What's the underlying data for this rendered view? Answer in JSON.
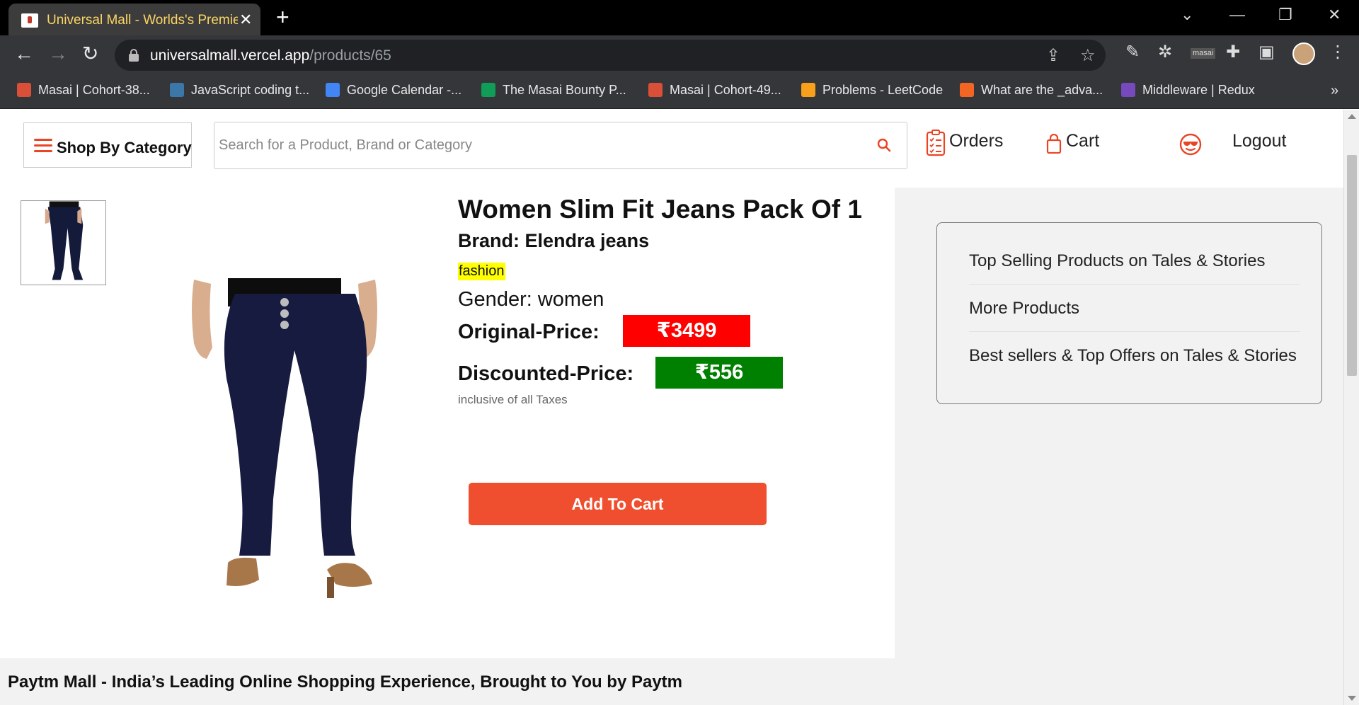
{
  "browser": {
    "tab_title": "Universal Mall - Worlds's Premier",
    "url_host": "universalmall.vercel.app",
    "url_path": "/products/65",
    "bookmarks": [
      {
        "label": "Masai | Cohort-38...",
        "color": "#d94f37"
      },
      {
        "label": "JavaScript coding t...",
        "color": "#3b77a8"
      },
      {
        "label": "Google Calendar -...",
        "color": "#4285f4"
      },
      {
        "label": "The Masai Bounty P...",
        "color": "#0f9d58"
      },
      {
        "label": "Masai | Cohort-49...",
        "color": "#d94f37"
      },
      {
        "label": "Problems - LeetCode",
        "color": "#f89f1b"
      },
      {
        "label": "What are the _adva...",
        "color": "#f26522"
      },
      {
        "label": "Middleware | Redux",
        "color": "#764abc"
      }
    ]
  },
  "header": {
    "category_label": "Shop By Category",
    "search_placeholder": "Search for a Product, Brand or Category",
    "orders_label": "Orders",
    "cart_label": "Cart",
    "logout_label": "Logout"
  },
  "product": {
    "title": "Women Slim Fit Jeans Pack Of 1",
    "brand": "Brand: Elendra jeans",
    "tag": "fashion",
    "gender": "Gender: women",
    "original_label": "Original-Price:",
    "original_price": "₹3499",
    "discounted_label": "Discounted-Price:",
    "discounted_price": "₹556",
    "tax_note": "inclusive of all Taxes",
    "add_to_cart": "Add To Cart"
  },
  "sidebar": {
    "items": [
      {
        "label": "Top Selling Products on Tales & Stories"
      },
      {
        "label": "More Products"
      },
      {
        "label": "Best sellers & Top Offers on Tales & Stories"
      }
    ]
  },
  "footer": {
    "text": "Paytm Mall - India’s Leading Online Shopping Experience, Brought to You by Paytm"
  },
  "colors": {
    "accent": "#ef4f2e",
    "original_price_bg": "#ff0000",
    "discounted_price_bg": "#008000",
    "tag_highlight": "#ffff00"
  }
}
